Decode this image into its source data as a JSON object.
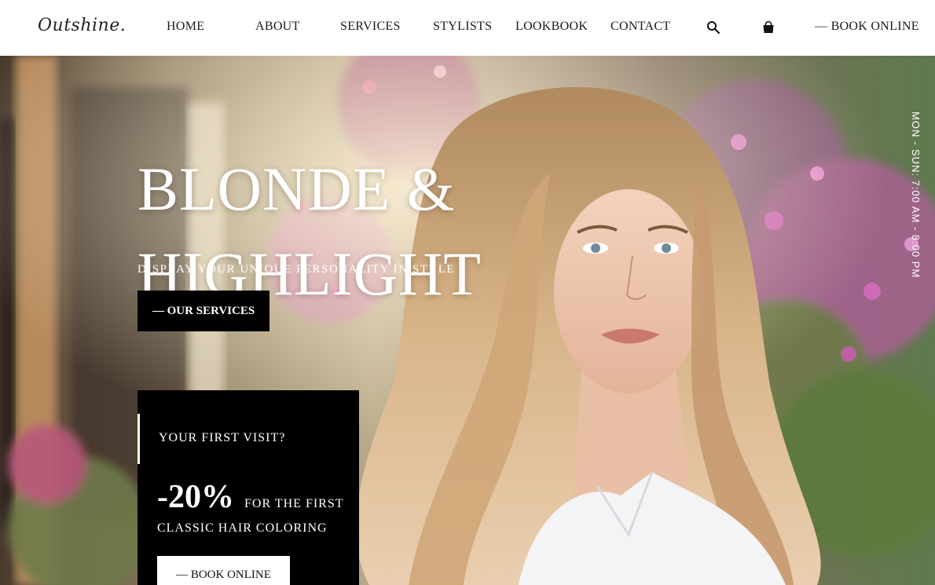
{
  "brand": {
    "logo": "Outshine."
  },
  "nav": {
    "items": [
      {
        "label": "HOME"
      },
      {
        "label": "ABOUT"
      },
      {
        "label": "SERVICES"
      },
      {
        "label": "STYLISTS"
      },
      {
        "label": "LOOKBOOK"
      },
      {
        "label": "CONTACT"
      }
    ],
    "search_icon": "search-icon",
    "cart_icon": "shopping-bag-icon",
    "book_label": "— BOOK ONLINE"
  },
  "hero": {
    "title_line1": "BLONDE &",
    "title_line2": "HIGHLIGHT",
    "subtitle": "DISPLAY YOUR UNIQUE PERSONALITY IN STYLE",
    "cta_label": "— OUR SERVICES",
    "hours": "MON - SUN: 7:00 AM - 8:00 PM"
  },
  "promo": {
    "question": "YOUR FIRST VISIT?",
    "discount": "-20%",
    "for_first": "FOR THE FIRST",
    "service": "CLASSIC HAIR COLORING",
    "cta_label": "— BOOK ONLINE"
  }
}
